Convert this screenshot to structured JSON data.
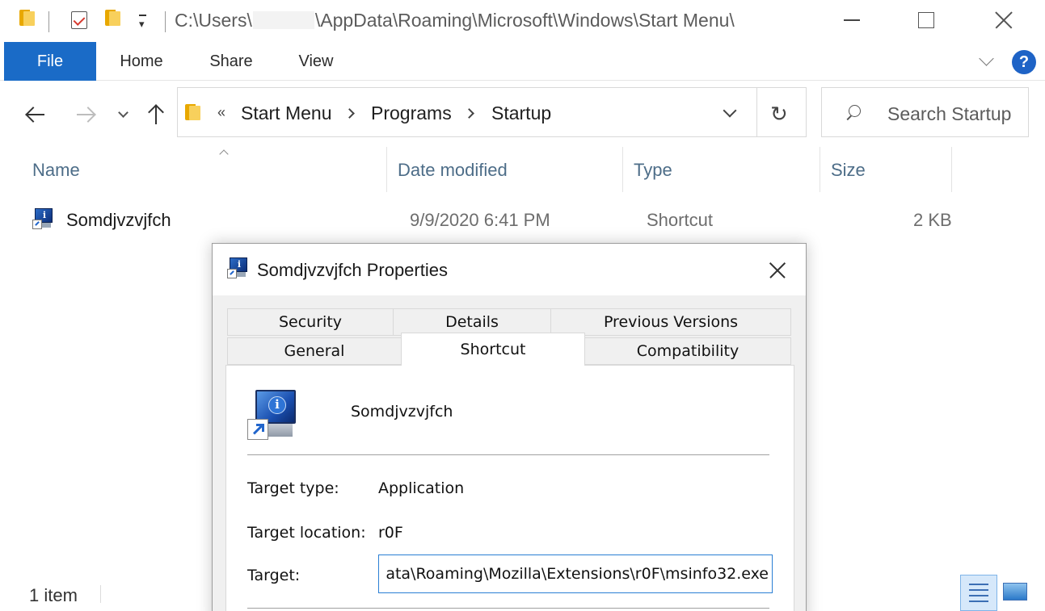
{
  "window": {
    "title_path_prefix": "C:\\Users\\",
    "title_path_suffix": "\\AppData\\Roaming\\Microsoft\\Windows\\Start Menu\\",
    "minimize": "minimize",
    "maximize": "maximize",
    "close": "close"
  },
  "ribbon": {
    "tabs": [
      {
        "label": "File"
      },
      {
        "label": "Home"
      },
      {
        "label": "Share"
      },
      {
        "label": "View"
      }
    ],
    "help": "?"
  },
  "address": {
    "collapsed_marker": "«",
    "crumbs": [
      "Start Menu",
      "Programs",
      "Startup"
    ],
    "refresh_glyph": "↻"
  },
  "search": {
    "placeholder": "Search Startup"
  },
  "columns": [
    "Name",
    "Date modified",
    "Type",
    "Size"
  ],
  "files": [
    {
      "name": "Somdjvzvjfch",
      "date_modified": "9/9/2020 6:41 PM",
      "type": "Shortcut",
      "size": "2 KB"
    }
  ],
  "status": {
    "item_count": "1 item"
  },
  "dialog": {
    "title": "Somdjvzvjfch Properties",
    "tabs_row1": [
      "Security",
      "Details",
      "Previous Versions"
    ],
    "tabs_row2": [
      "General",
      "Shortcut",
      "Compatibility"
    ],
    "active_tab": "Shortcut",
    "shortcut_name": "Somdjvzvjfch",
    "fields": {
      "target_type_label": "Target type:",
      "target_type_value": "Application",
      "target_location_label": "Target location:",
      "target_location_value": "r0F",
      "target_label": "Target:",
      "target_value": "ata\\Roaming\\Mozilla\\Extensions\\r0F\\msinfo32.exe"
    }
  },
  "colors": {
    "accent": "#1a6bc7",
    "folder": "#f8d05c",
    "header_text": "#4d6d88",
    "focus_border": "#2a7fd4"
  }
}
